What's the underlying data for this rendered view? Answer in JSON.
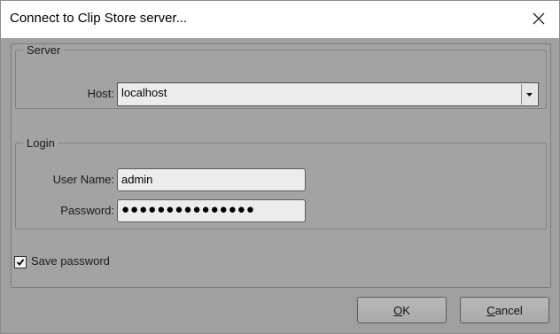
{
  "window": {
    "title": "Connect to Clip Store server..."
  },
  "server": {
    "legend": "Server",
    "host_label": "Host:",
    "host_value": "localhost"
  },
  "login": {
    "legend": "Login",
    "username_label": "User Name:",
    "username_value": "admin",
    "password_label": "Password:",
    "password_masked": "●●●●●●●●●●●●●●●"
  },
  "save_password": {
    "label": "Save password",
    "checked": true
  },
  "buttons": {
    "ok": {
      "label": "OK",
      "mnemonic": "O",
      "rest": "K"
    },
    "cancel": {
      "label": "Cancel",
      "mnemonic": "C",
      "rest": "ancel"
    }
  }
}
